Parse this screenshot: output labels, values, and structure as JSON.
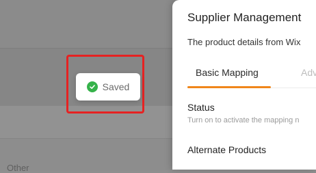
{
  "background": {
    "section_label": "Other"
  },
  "toast": {
    "icon": "check-circle-icon",
    "label": "Saved"
  },
  "panel": {
    "title": "Supplier Management",
    "description": "The product details from Wix",
    "tabs": [
      {
        "label": "Basic Mapping",
        "active": true
      },
      {
        "label": "Adv",
        "active": false
      }
    ],
    "status": {
      "title": "Status",
      "hint": "Turn on to activate the mapping n"
    },
    "alternate_products": {
      "title": "Alternate Products"
    }
  },
  "colors": {
    "accent": "#f0861a",
    "highlight": "#e62222",
    "success": "#35b24a"
  }
}
